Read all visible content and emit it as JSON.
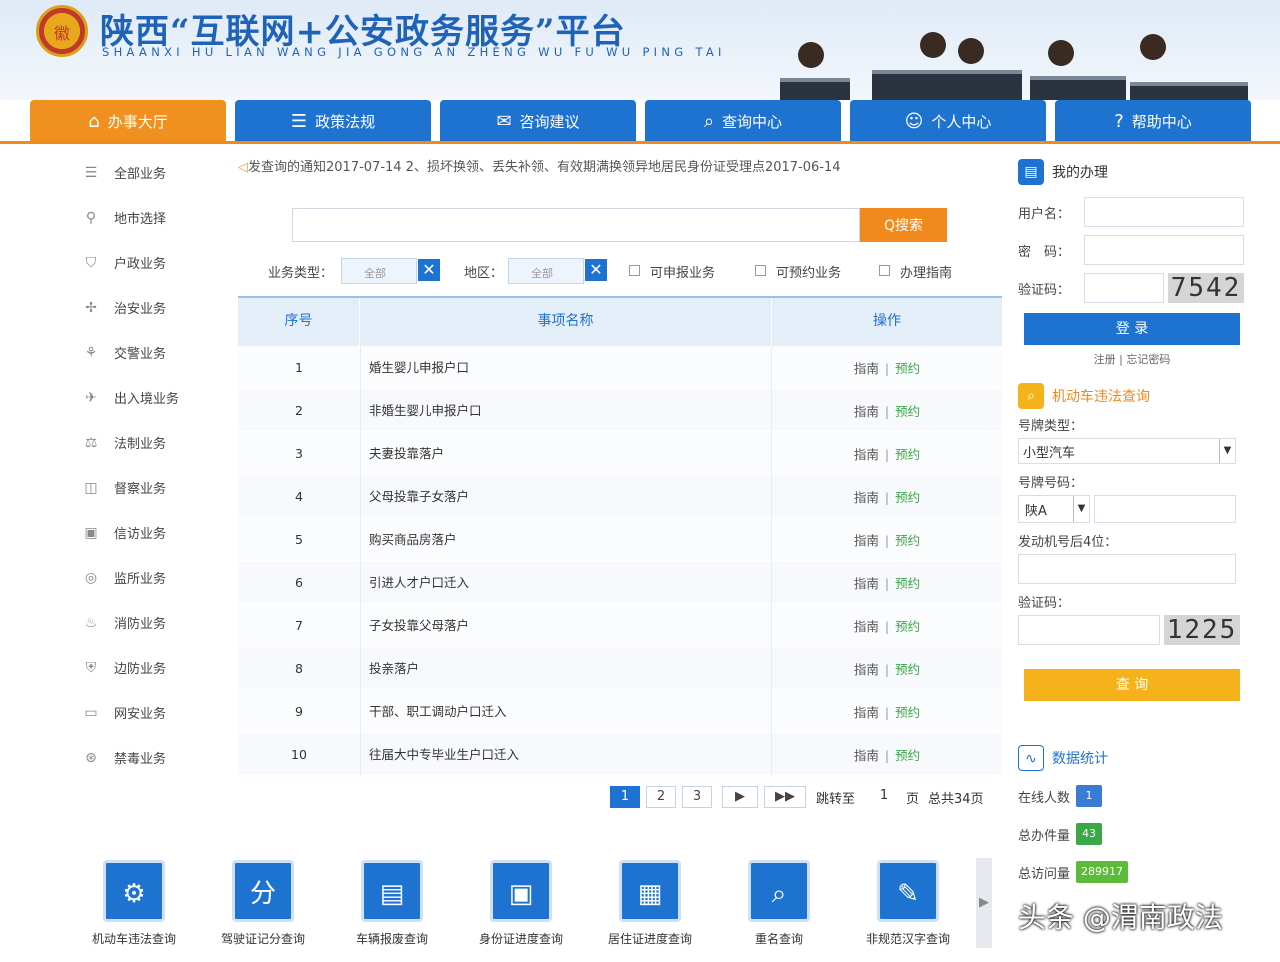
{
  "header": {
    "emblem_char": "徽",
    "title_cn": "陕西“互联网+公安政务服务”平台",
    "title_en": "SHAANXI HU LIAN WANG JIA GONG AN ZHENG WU FU WU PING TAI"
  },
  "nav": {
    "tabs": [
      {
        "label": "办事大厅",
        "icon": "home-icon",
        "glyph": "⌂",
        "active": true
      },
      {
        "label": "政策法规",
        "icon": "document-icon",
        "glyph": "☰",
        "active": false
      },
      {
        "label": "咨询建议",
        "icon": "chat-icon",
        "glyph": "✉",
        "active": false
      },
      {
        "label": "查询中心",
        "icon": "query-icon",
        "glyph": "⌕",
        "active": false
      },
      {
        "label": "个人中心",
        "icon": "user-icon",
        "glyph": "☺",
        "active": false
      },
      {
        "label": "帮助中心",
        "icon": "help-icon",
        "glyph": "?",
        "active": false
      }
    ]
  },
  "sidebar": {
    "items": [
      {
        "label": "全部业务",
        "glyph": "☰"
      },
      {
        "label": "地市选择",
        "glyph": "⚲"
      },
      {
        "label": "户政业务",
        "glyph": "⛉"
      },
      {
        "label": "治安业务",
        "glyph": "✢"
      },
      {
        "label": "交警业务",
        "glyph": "⚘"
      },
      {
        "label": "出入境业务",
        "glyph": "✈"
      },
      {
        "label": "法制业务",
        "glyph": "⚖"
      },
      {
        "label": "督察业务",
        "glyph": "◫"
      },
      {
        "label": "信访业务",
        "glyph": "▣"
      },
      {
        "label": "监所业务",
        "glyph": "◎"
      },
      {
        "label": "消防业务",
        "glyph": "♨"
      },
      {
        "label": "边防业务",
        "glyph": "⛨"
      },
      {
        "label": "网安业务",
        "glyph": "▭"
      },
      {
        "label": "禁毒业务",
        "glyph": "⊛"
      }
    ]
  },
  "notice": {
    "text": "发查询的通知2017-07-14    2、损坏换领、丢失补领、有效期满换领异地居民身份证受理点2017-06-14"
  },
  "search": {
    "placeholder": "",
    "button_label": "Q搜索"
  },
  "filters": {
    "type_label": "业务类型：",
    "type_value": "全部",
    "district_label": "地区：",
    "district_value": "全部",
    "online_label": "可申报业务",
    "booking_label": "可预约业务",
    "guide_label": "办理指南"
  },
  "table": {
    "headers": [
      "序号",
      "事项名称",
      "操作"
    ],
    "guide_label": "指南",
    "book_label": "预约",
    "sep": "|",
    "rows": [
      {
        "no": "1",
        "name": "婚生婴儿申报户口"
      },
      {
        "no": "2",
        "name": "非婚生婴儿申报户口"
      },
      {
        "no": "3",
        "name": "夫妻投靠落户"
      },
      {
        "no": "4",
        "name": "父母投靠子女落户"
      },
      {
        "no": "5",
        "name": "购买商品房落户"
      },
      {
        "no": "6",
        "name": "引进人才户口迁入"
      },
      {
        "no": "7",
        "name": "子女投靠父母落户"
      },
      {
        "no": "8",
        "name": "投亲落户"
      },
      {
        "no": "9",
        "name": "干部、职工调动户口迁入"
      },
      {
        "no": "10",
        "name": "往届大中专毕业生户口迁入"
      }
    ]
  },
  "pager": {
    "pages": [
      "1",
      "2",
      "3"
    ],
    "next": "▶",
    "last": "▶▶",
    "jump_label": "跳转至",
    "jump_value": "1",
    "page_unit": "页",
    "total": "总共34页"
  },
  "login": {
    "title": "我的办理",
    "username_label": "用户名：",
    "password_label": "密　码：",
    "captcha_label": "验证码：",
    "captcha_value": "7542",
    "button": "登 录",
    "register": "注册",
    "forgot": "忘记密码",
    "divider": "|"
  },
  "violation": {
    "title": "机动车违法查询",
    "plate_type_label": "号牌类型：",
    "plate_type_value": "小型汽车",
    "plate_no_label": "号牌号码：",
    "plate_prefix": "陕A",
    "engine_label": "发动机号后4位：",
    "captcha_label": "验证码：",
    "captcha_value": "1225",
    "button": "查 询"
  },
  "stats": {
    "title": "数据统计",
    "online_label": "在线人数",
    "online_value": "1",
    "total_label": "总办件量",
    "total_value": "43",
    "visits_label": "总访问量",
    "visits_value": "289917"
  },
  "services": [
    {
      "label": "机动车违法查询",
      "icon": "car-violation-icon",
      "glyph": "⚙"
    },
    {
      "label": "驾驶证记分查询",
      "icon": "license-score-icon",
      "glyph": "分"
    },
    {
      "label": "车辆报废查询",
      "icon": "vehicle-scrap-icon",
      "glyph": "▤"
    },
    {
      "label": "身份证进度查询",
      "icon": "id-card-icon",
      "glyph": "▣"
    },
    {
      "label": "居住证进度查询",
      "icon": "residence-card-icon",
      "glyph": "▦"
    },
    {
      "label": "重名查询",
      "icon": "name-search-icon",
      "glyph": "⌕"
    },
    {
      "label": "非规范汉字查询",
      "icon": "char-search-icon",
      "glyph": "✎"
    }
  ],
  "watermark": "头条 @渭南政法",
  "colors": {
    "primary": "#1f73d0",
    "accent": "#f08a1c",
    "booking": "#3aa847",
    "query": "#f6b21b"
  }
}
